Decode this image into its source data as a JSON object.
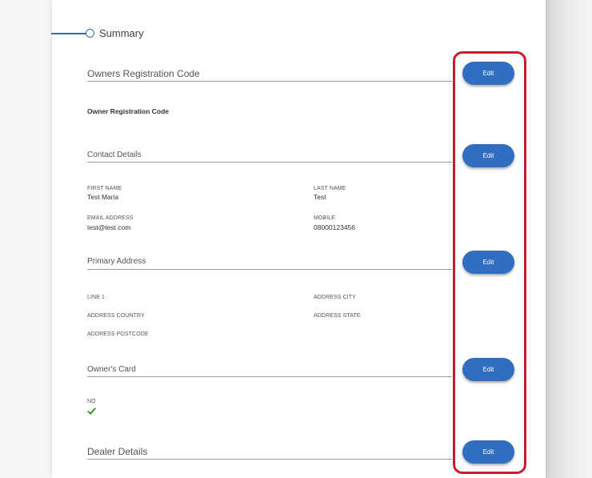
{
  "summary": {
    "title": "Summary"
  },
  "sections": {
    "owners_registration": {
      "title": "Owners Registration Code",
      "edit_label": "Edit",
      "field_label": "Owner Registration Code"
    },
    "contact": {
      "title": "Contact Details",
      "edit_label": "Edit",
      "first_name_label": "FIRST NAME",
      "first_name_value": "Test Maria",
      "last_name_label": "LAST NAME",
      "last_name_value": "Test",
      "email_label": "EMAIL ADDRESS",
      "email_value": "test@test.com",
      "mobile_label": "MOBILE",
      "mobile_value": "08000123456"
    },
    "primary_address": {
      "title": "Primary Address",
      "edit_label": "Edit",
      "line1_label": "LINE 1",
      "city_label": "ADDRESS CITY",
      "country_label": "ADDRESS COUNTRY",
      "state_label": "ADDRESS STATE",
      "postcode_label": "ADDRESS POSTCODE"
    },
    "owners_card": {
      "title": "Owner's Card",
      "edit_label": "Edit",
      "no_label": "NO",
      "check_icon": "checkmark-icon"
    },
    "dealer": {
      "title": "Dealer Details",
      "edit_label": "Edit"
    }
  },
  "colors": {
    "accent": "#2f6ec0",
    "highlight": "#c61e2d",
    "check": "#2e9e2e"
  }
}
